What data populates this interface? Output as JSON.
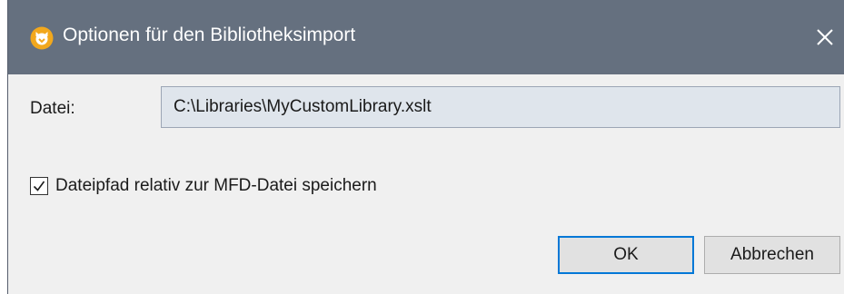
{
  "window": {
    "title": "Optionen für den Bibliotheksimport",
    "icon": "mapforce-app-icon",
    "close_icon": "close-icon"
  },
  "colors": {
    "titlebar": "#65707f",
    "dialog_bg": "#f0f0f0",
    "input_bg": "#dfe5ec",
    "accent": "#0078d7"
  },
  "form": {
    "file_label": "Datei:",
    "file_value": "C:\\Libraries\\MyCustomLibrary.xslt",
    "relative_path_checkbox": {
      "label": "Dateipfad relativ zur MFD-Datei speichern",
      "checked": true
    }
  },
  "buttons": {
    "ok_label": "OK",
    "cancel_label": "Abbrechen"
  }
}
